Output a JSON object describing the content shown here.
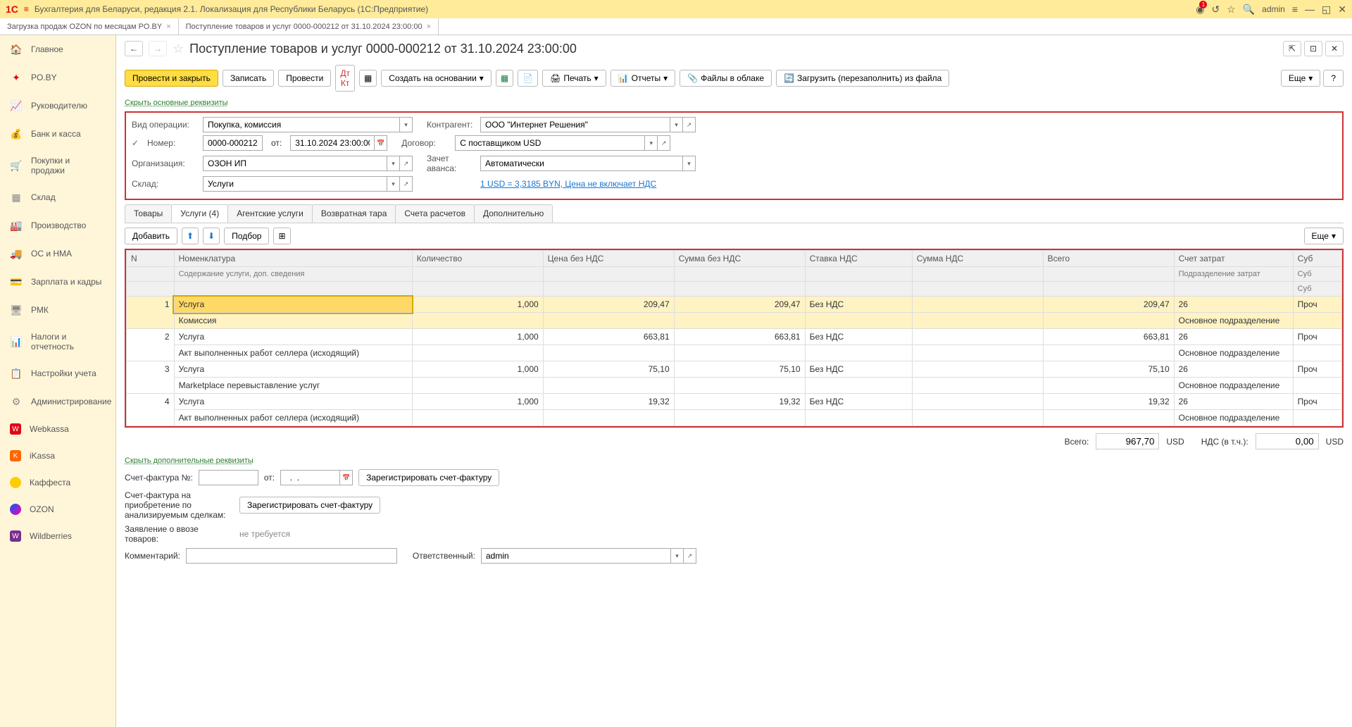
{
  "titlebar": {
    "app_name": "Бухгалтерия для Беларуси, редакция 2.1. Локализация для Республики Беларусь  (1С:Предприятие)",
    "user": "admin"
  },
  "window_tabs": [
    {
      "label": "Загрузка продаж OZON по месяцам PO.BY",
      "active": false
    },
    {
      "label": "Поступление товаров и услуг 0000-000212 от 31.10.2024 23:00:00",
      "active": true
    }
  ],
  "sidebar": {
    "items": [
      {
        "label": "Главное",
        "icon": "icon-home",
        "glyph": "🏠"
      },
      {
        "label": "PO.BY",
        "icon": "icon-poby",
        "glyph": "✦"
      },
      {
        "label": "Руководителю",
        "icon": "icon-ruko",
        "glyph": "📈"
      },
      {
        "label": "Банк и касса",
        "icon": "icon-bank",
        "glyph": "💰"
      },
      {
        "label": "Покупки и продажи",
        "icon": "icon-pokupki",
        "glyph": "🛒"
      },
      {
        "label": "Склад",
        "icon": "icon-sklad",
        "glyph": "▦"
      },
      {
        "label": "Производство",
        "icon": "icon-proiz",
        "glyph": "🏭"
      },
      {
        "label": "ОС и НМА",
        "icon": "icon-os",
        "glyph": "🚚"
      },
      {
        "label": "Зарплата и кадры",
        "icon": "icon-zarplata",
        "glyph": "💳"
      },
      {
        "label": "РМК",
        "icon": "icon-rmk",
        "glyph": "🖥"
      },
      {
        "label": "Налоги и отчетность",
        "icon": "icon-nalogi",
        "glyph": "📊"
      },
      {
        "label": "Настройки учета",
        "icon": "icon-nastr",
        "glyph": "📋"
      },
      {
        "label": "Администрирование",
        "icon": "icon-admin",
        "glyph": "⚙"
      },
      {
        "label": "Webkassa",
        "icon": "icon-web",
        "glyph": "W"
      },
      {
        "label": "iKassa",
        "icon": "icon-ikassa",
        "glyph": "K"
      },
      {
        "label": "Каффеста",
        "icon": "icon-kaf",
        "glyph": ""
      },
      {
        "label": "OZON",
        "icon": "icon-ozon",
        "glyph": ""
      },
      {
        "label": "Wildberries",
        "icon": "icon-wb",
        "glyph": "W"
      }
    ]
  },
  "page": {
    "title": "Поступление товаров и услуг 0000-000212 от 31.10.2024 23:00:00"
  },
  "toolbar": {
    "post_close": "Провести и закрыть",
    "save": "Записать",
    "post": "Провести",
    "create_based": "Создать на основании",
    "print": "Печать",
    "reports": "Отчеты",
    "files_cloud": "Файлы в облаке",
    "reload_from_file": "Загрузить (перезаполнить) из файла",
    "more": "Еще",
    "help": "?"
  },
  "links": {
    "hide_main": "Скрыть основные реквизиты",
    "hide_add": "Скрыть дополнительные реквизиты",
    "currency": "1 USD = 3,3185 BYN,  Цена не включает НДС"
  },
  "form": {
    "vid_label": "Вид операции:",
    "vid_value": "Покупка, комиссия",
    "kontr_label": "Контрагент:",
    "kontr_value": "ООО \"Интернет Решения\"",
    "nomer_label": "Номер:",
    "nomer_value": "0000-000212",
    "ot_label": "от:",
    "ot_value": "31.10.2024 23:00:00",
    "dogovor_label": "Договор:",
    "dogovor_value": "С поставщиком USD",
    "org_label": "Организация:",
    "org_value": "ОЗОН ИП",
    "zachet_label": "Зачет аванса:",
    "zachet_value": "Автоматически",
    "sklad_label": "Склад:",
    "sklad_value": "Услуги"
  },
  "doc_tabs": [
    {
      "label": "Товары",
      "active": false
    },
    {
      "label": "Услуги (4)",
      "active": true
    },
    {
      "label": "Агентские услуги",
      "active": false
    },
    {
      "label": "Возвратная тара",
      "active": false
    },
    {
      "label": "Счета расчетов",
      "active": false
    },
    {
      "label": "Дополнительно",
      "active": false
    }
  ],
  "table_toolbar": {
    "add": "Добавить",
    "podbor": "Подбор",
    "more": "Еще"
  },
  "table": {
    "headers": {
      "n": "N",
      "nomen": "Номенклатура",
      "soderzh": "Содержание услуги, доп. сведения",
      "kol": "Количество",
      "cena": "Цена без НДС",
      "summa": "Сумма без НДС",
      "stavka": "Ставка НДС",
      "nds": "Сумма НДС",
      "vsego": "Всего",
      "schet": "Счет затрат",
      "podr": "Подразделение затрат",
      "sub": "Суб"
    },
    "rows": [
      {
        "n": 1,
        "nomen": "Услуга",
        "soderzh": "Комиссия",
        "kol": "1,000",
        "cena": "209,47",
        "summa": "209,47",
        "stavka": "Без НДС",
        "nds": "",
        "vsego": "209,47",
        "schet": "26",
        "podr": "Основное подразделение",
        "sub": "Проч",
        "selected": true
      },
      {
        "n": 2,
        "nomen": "Услуга",
        "soderzh": "Акт выполненных работ селлера (исходящий)",
        "kol": "1,000",
        "cena": "663,81",
        "summa": "663,81",
        "stavka": "Без НДС",
        "nds": "",
        "vsego": "663,81",
        "schet": "26",
        "podr": "Основное подразделение",
        "sub": "Проч"
      },
      {
        "n": 3,
        "nomen": "Услуга",
        "soderzh": "Marketplace перевыставление услуг",
        "kol": "1,000",
        "cena": "75,10",
        "summa": "75,10",
        "stavka": "Без НДС",
        "nds": "",
        "vsego": "75,10",
        "schet": "26",
        "podr": "Основное подразделение",
        "sub": "Проч"
      },
      {
        "n": 4,
        "nomen": "Услуга",
        "soderzh": "Акт выполненных работ селлера (исходящий)",
        "kol": "1,000",
        "cena": "19,32",
        "summa": "19,32",
        "stavka": "Без НДС",
        "nds": "",
        "vsego": "19,32",
        "schet": "26",
        "podr": "Основное подразделение",
        "sub": "Проч"
      }
    ]
  },
  "totals": {
    "vsego_label": "Всего:",
    "vsego_value": "967,70",
    "vsego_cur": "USD",
    "nds_label": "НДС (в т.ч.):",
    "nds_value": "0,00",
    "nds_cur": "USD"
  },
  "footer": {
    "sf_num_label": "Счет-фактура №:",
    "sf_ot_label": "от:",
    "sf_reg_btn": "Зарегистрировать счет-фактуру",
    "sf_priob_label": "Счет-фактура на приобретение по анализируемым сделкам:",
    "sf_priob_btn": "Зарегистрировать счет-фактуру",
    "zayav_label": "Заявление о ввозе товаров:",
    "zayav_value": "не требуется",
    "komm_label": "Комментарий:",
    "otv_label": "Ответственный:",
    "otv_value": "admin"
  }
}
